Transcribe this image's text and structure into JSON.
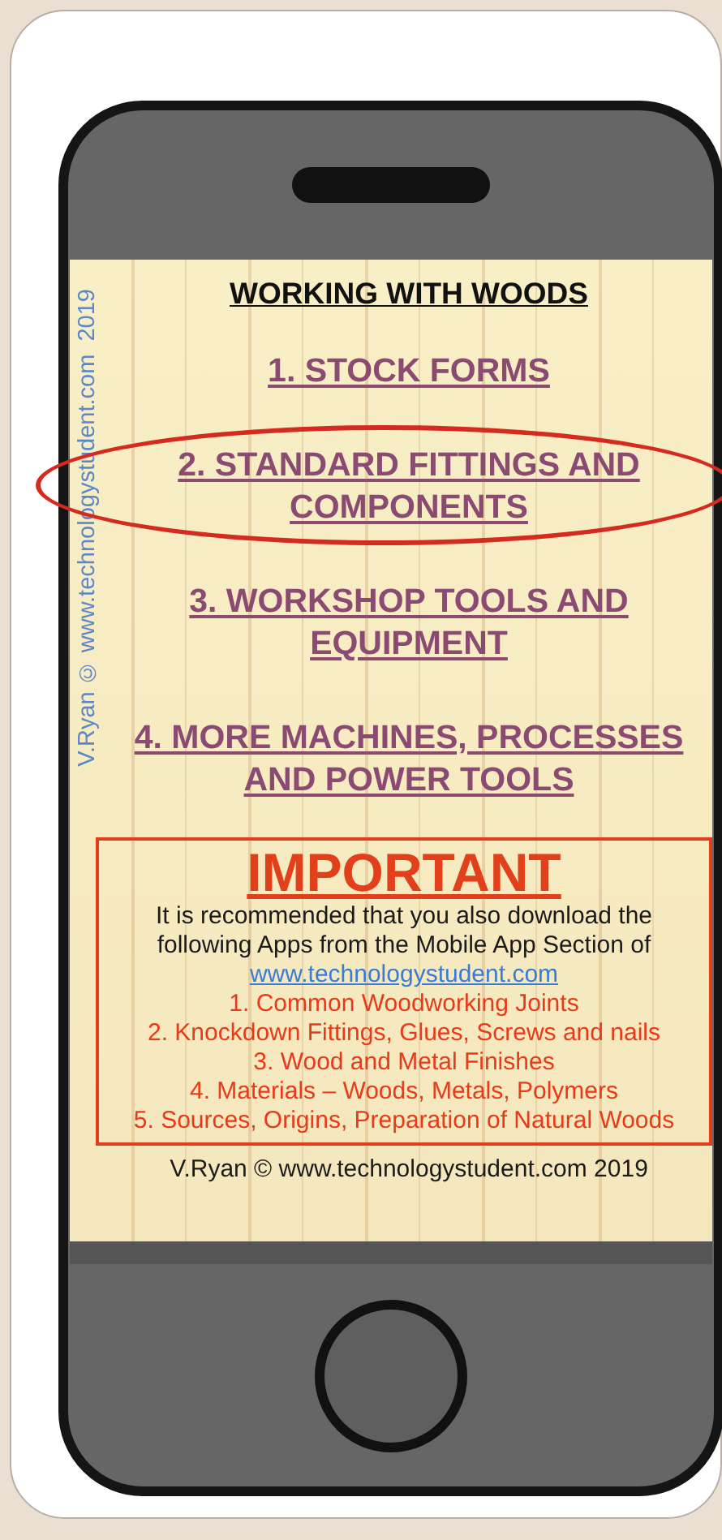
{
  "side_caption": "V.Ryan © www.technologystudent.com  2019",
  "title": "WORKING WITH WOODS",
  "menu": [
    {
      "label": "1. STOCK FORMS",
      "selected": false
    },
    {
      "label": "2. STANDARD FITTINGS AND COMPONENTS",
      "selected": true
    },
    {
      "label": "3. WORKSHOP TOOLS AND EQUIPMENT",
      "selected": false
    },
    {
      "label": "4. MORE MACHINES, PROCESSES AND POWER TOOLS",
      "selected": false
    }
  ],
  "notice": {
    "heading": "IMPORTANT",
    "text": "It is recommended that you also download the following Apps from the Mobile App Section of",
    "link": "www.technologystudent.com",
    "apps": [
      "1. Common Woodworking Joints",
      "2. Knockdown Fittings, Glues, Screws and nails",
      "3. Wood and Metal Finishes",
      "4. Materials – Woods, Metals, Polymers",
      "5. Sources, Origins, Preparation of Natural Woods"
    ]
  },
  "footer": "V.Ryan © www.technologystudent.com 2019"
}
